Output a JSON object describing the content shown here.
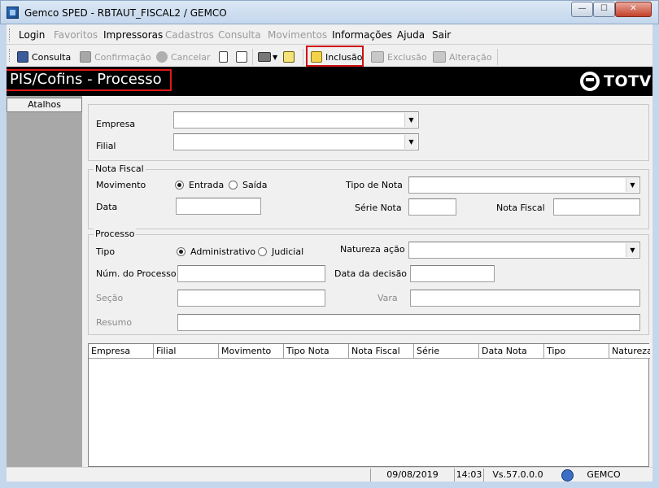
{
  "window": {
    "title": "Gemco SPED - RBTAUT_FISCAL2 / GEMCO",
    "min_symbol": "—",
    "max_symbol": "☐",
    "close_symbol": "✕"
  },
  "menu": {
    "items": [
      {
        "label": "Login",
        "enabled": true
      },
      {
        "label": "Favoritos",
        "enabled": false
      },
      {
        "label": "Impressoras",
        "enabled": true
      },
      {
        "label": "Cadastros",
        "enabled": false
      },
      {
        "label": "Consulta",
        "enabled": false
      },
      {
        "label": "Movimentos",
        "enabled": false
      },
      {
        "label": "Informações",
        "enabled": true
      },
      {
        "label": "Ajuda",
        "enabled": true
      },
      {
        "label": "Sair",
        "enabled": true
      }
    ]
  },
  "toolbar": {
    "consulta": "Consulta",
    "confirmacao": "Confirmação",
    "cancelar": "Cancelar",
    "inclusao": "Inclusão",
    "exclusao": "Exclusão",
    "alteracao": "Alteração"
  },
  "header": {
    "title": "PIS/Cofins - Processo",
    "logo": "TOTVS"
  },
  "left_panel": {
    "tab": "Atalhos"
  },
  "company_section": {
    "empresa_label": "Empresa",
    "empresa_value": "",
    "filial_label": "Filial",
    "filial_value": ""
  },
  "nota_fiscal": {
    "legend": "Nota Fiscal",
    "movimento_label": "Movimento",
    "radio_entrada": "Entrada",
    "radio_saida": "Saída",
    "selected": "Entrada",
    "tipo_nota_label": "Tipo de Nota",
    "tipo_nota_value": "",
    "data_label": "Data",
    "data_value": "",
    "serie_label": "Série Nota",
    "serie_value": "",
    "nota_label": "Nota Fiscal",
    "nota_value": ""
  },
  "processo": {
    "legend": "Processo",
    "tipo_label": "Tipo",
    "radio_admin": "Administrativo",
    "radio_judicial": "Judicial",
    "selected": "Administrativo",
    "natureza_label": "Natureza ação",
    "natureza_value": "",
    "num_label": "Núm. do Processo",
    "num_value": "",
    "data_decisao_label": "Data da decisão",
    "data_decisao_value": "",
    "secao_label": "Seção",
    "secao_value": "",
    "vara_label": "Vara",
    "vara_value": "",
    "resumo_label": "Resumo",
    "resumo_value": ""
  },
  "grid": {
    "columns": [
      "Empresa",
      "Filial",
      "Movimento",
      "Tipo Nota",
      "Nota Fiscal",
      "Série",
      "Data Nota",
      "Tipo",
      "Natureza"
    ],
    "rows": []
  },
  "status": {
    "date": "09/08/2019",
    "time": "14:03",
    "version": "Vs.57.0.0.0",
    "company": "GEMCO"
  },
  "colors": {
    "highlight": "#e01818",
    "header_bg": "#000000",
    "sidebar_bg": "#a8a8a8"
  }
}
